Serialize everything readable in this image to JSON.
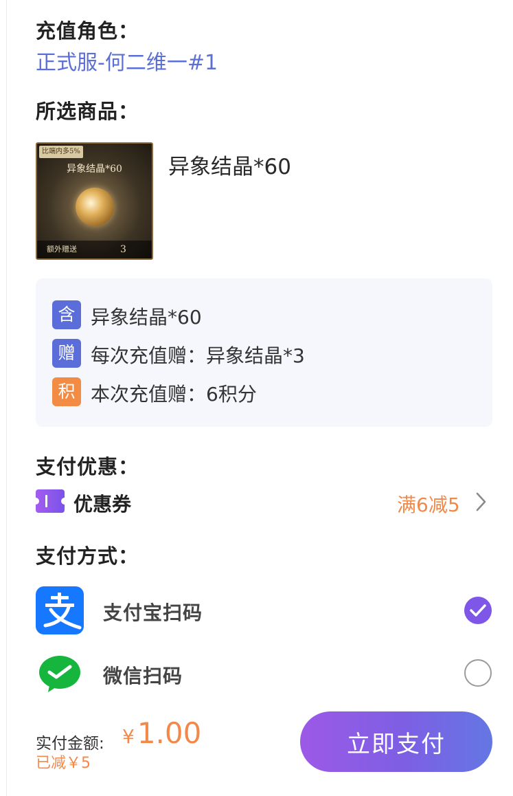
{
  "role": {
    "heading": "充值角色：",
    "value": "正式服-何二维一#1"
  },
  "product": {
    "heading": "所选商品：",
    "name": "异象结晶*60",
    "thumb": {
      "badge": "比端内多5%",
      "title": "异象结晶*60",
      "bonus_label": "额外赠送",
      "bonus_count": "3"
    }
  },
  "details": [
    {
      "tag": "含",
      "tag_color": "#5b6dd9",
      "text": "异象结晶*60"
    },
    {
      "tag": "赠",
      "tag_color": "#5b6dd9",
      "text": "每次充值赠：异象结晶*3"
    },
    {
      "tag": "积",
      "tag_color": "#f28c45",
      "text": "本次充值赠：6积分"
    }
  ],
  "discount": {
    "heading": "支付优惠：",
    "coupon_label": "优惠券",
    "coupon_value": "满6减5",
    "icon": "coupon-ticket-icon"
  },
  "payment": {
    "heading": "支付方式：",
    "methods": [
      {
        "label": "支付宝扫码",
        "icon": "alipay-icon",
        "selected": true
      },
      {
        "label": "微信扫码",
        "icon": "wechat-icon",
        "selected": false
      }
    ]
  },
  "footer": {
    "total_label": "实付金额:",
    "currency": "¥",
    "total_amount": "1.00",
    "saved": "已减￥5",
    "pay_button": "立即支付"
  },
  "colors": {
    "accent": "#7e56e8",
    "price": "#f2894a",
    "link": "#5b6fd6"
  }
}
